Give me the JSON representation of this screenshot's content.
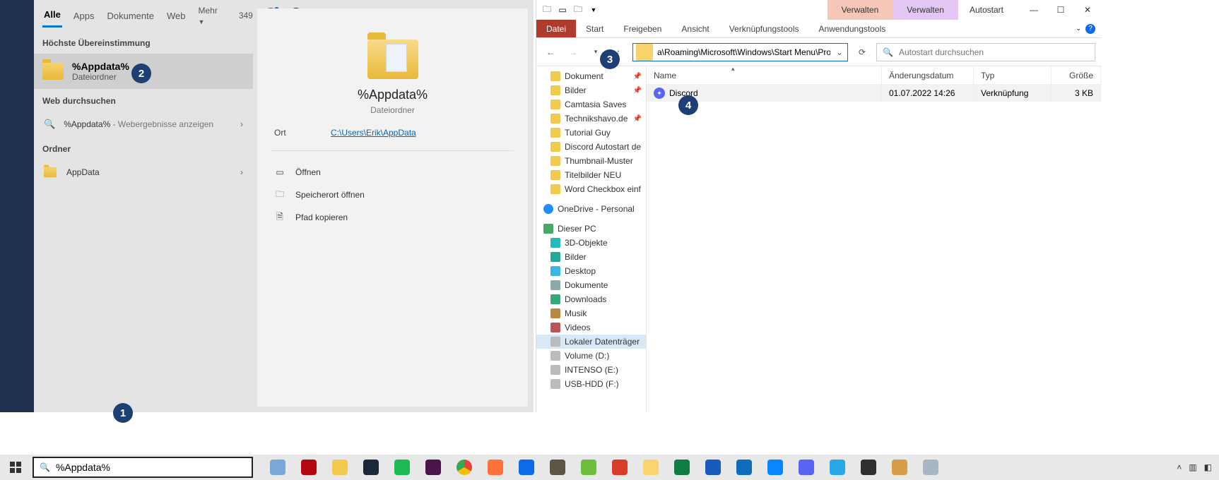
{
  "annotations": {
    "b1": "1",
    "b2": "2",
    "b3": "3",
    "b4": "4"
  },
  "search": {
    "tabs": {
      "all": "Alle",
      "apps": "Apps",
      "docs": "Dokumente",
      "web": "Web",
      "more": "Mehr"
    },
    "reward_count": "349",
    "best_h": "Höchste Übereinstimmung",
    "best_title": "%Appdata%",
    "best_sub": "Dateiordner",
    "web_h": "Web durchsuchen",
    "web_q": "%Appdata%",
    "web_tail": " - Webergebnisse anzeigen",
    "folder_h": "Ordner",
    "folder_item": "AppData",
    "preview_title": "%Appdata%",
    "preview_sub": "Dateiordner",
    "location_k": "Ort",
    "location_v": "C:\\Users\\Erik\\AppData",
    "act_open": "Öffnen",
    "act_loc": "Speicherort öffnen",
    "act_copy": "Pfad kopieren",
    "taskbar_query": "%Appdata%"
  },
  "explorer": {
    "ctx1": "Verwalten",
    "ctx2": "Verwalten",
    "title": "Autostart",
    "rb_file": "Datei",
    "rb_start": "Start",
    "rb_share": "Freigeben",
    "rb_view": "Ansicht",
    "rb_link": "Verknüpfungstools",
    "rb_app": "Anwendungstools",
    "address": "a\\Roaming\\Microsoft\\Windows\\Start Menu\\Programs\\Startup",
    "search_ph": "Autostart durchsuchen",
    "cols": {
      "name": "Name",
      "date": "Änderungsdatum",
      "type": "Typ",
      "size": "Größe"
    },
    "file": {
      "name": "Discord",
      "date": "01.07.2022 14:26",
      "type": "Verknüpfung",
      "size": "3 KB"
    },
    "nav": {
      "dokumente": "Dokument",
      "bilder": "Bilder",
      "camtasia": "Camtasia Saves",
      "technik": "Technikshavo.de",
      "tutorial": "Tutorial Guy",
      "discordauto": "Discord Autostart de",
      "thumb": "Thumbnail-Muster",
      "titel": "Titelbilder NEU",
      "wordcb": "Word Checkbox einf",
      "onedrive": "OneDrive - Personal",
      "dieserpc": "Dieser PC",
      "objekte3d": "3D-Objekte",
      "bilder2": "Bilder",
      "desktop": "Desktop",
      "dokumente2": "Dokumente",
      "downloads": "Downloads",
      "musik": "Musik",
      "videos": "Videos",
      "lokal": "Lokaler Datenträger",
      "vold": "Volume (D:)",
      "intenso": "INTENSO (E:)",
      "usbhdd": "USB-HDD (F:)"
    }
  },
  "taskbar_apps": [
    {
      "n": "task-view",
      "c": "#7aa7d8"
    },
    {
      "n": "netflix",
      "c": "#b20710"
    },
    {
      "n": "explorer",
      "c": "#f3c94e"
    },
    {
      "n": "steam",
      "c": "#1b2838"
    },
    {
      "n": "spotify",
      "c": "#1db954"
    },
    {
      "n": "slack",
      "c": "#4a154b"
    },
    {
      "n": "chrome",
      "c": "#fff"
    },
    {
      "n": "firefox",
      "c": "#ff7139"
    },
    {
      "n": "edge",
      "c": "#0b6be8"
    },
    {
      "n": "gimp",
      "c": "#5c5543"
    },
    {
      "n": "camtasia",
      "c": "#6bbf3b"
    },
    {
      "n": "ccleaner",
      "c": "#d63b2b"
    },
    {
      "n": "audacity",
      "c": "#f8d66d"
    },
    {
      "n": "excel",
      "c": "#107c41"
    },
    {
      "n": "word",
      "c": "#185abd"
    },
    {
      "n": "outlook",
      "c": "#0f6cbd"
    },
    {
      "n": "thunderbird",
      "c": "#0a84ff"
    },
    {
      "n": "discord",
      "c": "#5865f2"
    },
    {
      "n": "telegram",
      "c": "#28a8e9"
    },
    {
      "n": "obs",
      "c": "#302e31"
    },
    {
      "n": "snip",
      "c": "#d89c4a"
    },
    {
      "n": "generic",
      "c": "#a9b6c6"
    }
  ]
}
